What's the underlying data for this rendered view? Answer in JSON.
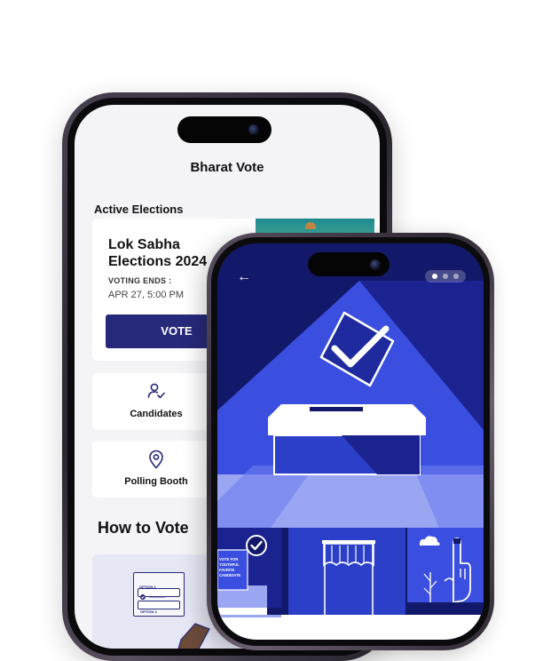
{
  "back_phone": {
    "app_title": "Bharat Vote",
    "section_title": "Active Elections",
    "election": {
      "name": "Lok Sabha Elections 2024",
      "ends_label": "VOTING ENDS :",
      "ends_value": "APR 27, 5:00 PM",
      "vote_label": "VOTE"
    },
    "tiles": [
      {
        "label": "Candidates",
        "icon": "person-check-icon"
      },
      {
        "label": "Polling Booth",
        "icon": "location-pin-icon"
      }
    ],
    "how_to_vote": {
      "title": "How to Vote",
      "option_1": "OPTION 1",
      "option_2": "OPTION 2"
    }
  },
  "front_phone": {
    "back_icon": "←",
    "pager": {
      "count": 3,
      "active": 0
    },
    "ballot_slip_text": "VOTE FOR YOUTHFUL FAVRITE CANDIDATE"
  },
  "colors": {
    "primary": "#27297a",
    "illustration_dark": "#13196a",
    "illustration_mid": "#2c3fc8",
    "illustration_light": "#4a5ee8",
    "illustration_pale": "#9aa6f2"
  }
}
